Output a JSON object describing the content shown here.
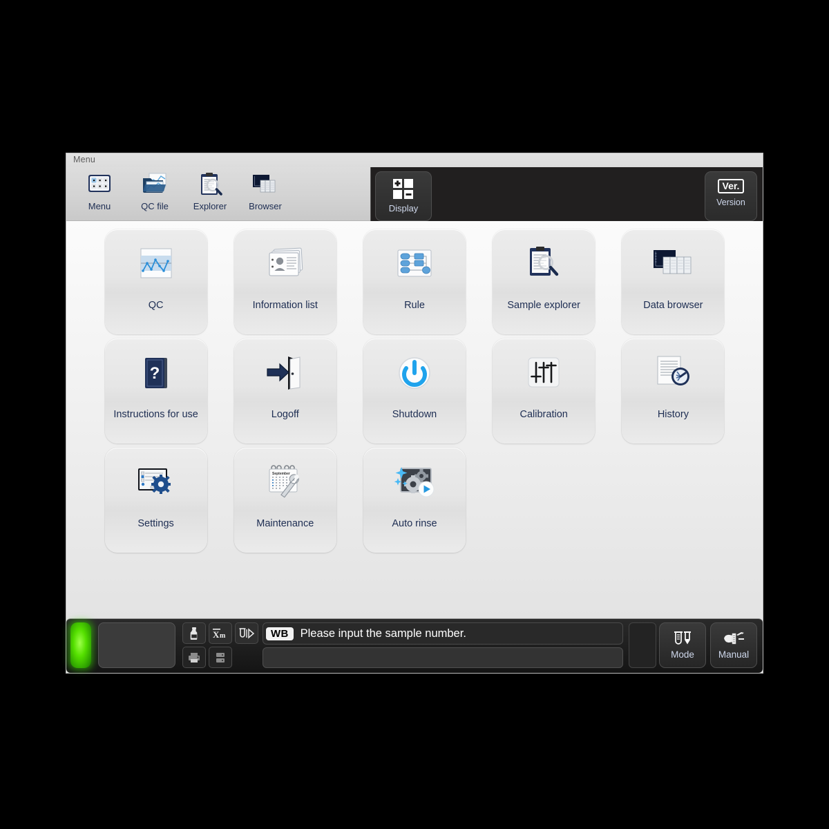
{
  "window": {
    "title": "Menu"
  },
  "toolbar": {
    "buttons": [
      {
        "label": "Menu",
        "icon": "menu-grid-icon"
      },
      {
        "label": "QC file",
        "icon": "qc-file-icon"
      },
      {
        "label": "Explorer",
        "icon": "explorer-icon"
      },
      {
        "label": "Browser",
        "icon": "browser-icon"
      }
    ],
    "display_tab": {
      "label": "Display",
      "icon": "display-quad-icon"
    },
    "version_button": {
      "badge": "Ver.",
      "label": "Version"
    }
  },
  "menu_grid": {
    "tiles": [
      {
        "label": "QC",
        "icon": "qc-chart-icon"
      },
      {
        "label": "Information list",
        "icon": "information-list-icon"
      },
      {
        "label": "Rule",
        "icon": "rule-flow-icon"
      },
      {
        "label": "Sample explorer",
        "icon": "sample-explorer-icon"
      },
      {
        "label": "Data browser",
        "icon": "data-browser-icon"
      },
      {
        "label": "Instructions for use",
        "icon": "manual-book-icon"
      },
      {
        "label": "Logoff",
        "icon": "logoff-door-icon"
      },
      {
        "label": "Shutdown",
        "icon": "power-icon"
      },
      {
        "label": "Calibration",
        "icon": "sliders-icon"
      },
      {
        "label": "History",
        "icon": "history-clock-icon"
      },
      {
        "label": "Settings",
        "icon": "settings-gear-icon"
      },
      {
        "label": "Maintenance",
        "icon": "maintenance-wrench-icon"
      },
      {
        "label": "Auto rinse",
        "icon": "auto-rinse-icon"
      }
    ]
  },
  "statusbar": {
    "led": {
      "state": "ready",
      "color": "#3cd000"
    },
    "icons": [
      {
        "name": "reagent-bottle-icon"
      },
      {
        "name": "xm-mean-icon"
      },
      {
        "name": "sample-aspirate-icon"
      },
      {
        "name": "printer-icon"
      },
      {
        "name": "host-transmit-icon"
      }
    ],
    "mode_badge": "WB",
    "message": "Please input the sample number.",
    "sample_input": {
      "value": "",
      "placeholder": ""
    },
    "buttons": [
      {
        "label": "Mode",
        "icon": "tubes-icon"
      },
      {
        "label": "Manual",
        "icon": "manual-hand-icon"
      }
    ]
  },
  "colors": {
    "accent_text": "#1d2d52",
    "dark_panel": "#211f1f",
    "led_green": "#3cd000",
    "icon_blue": "#3a8fd4"
  }
}
